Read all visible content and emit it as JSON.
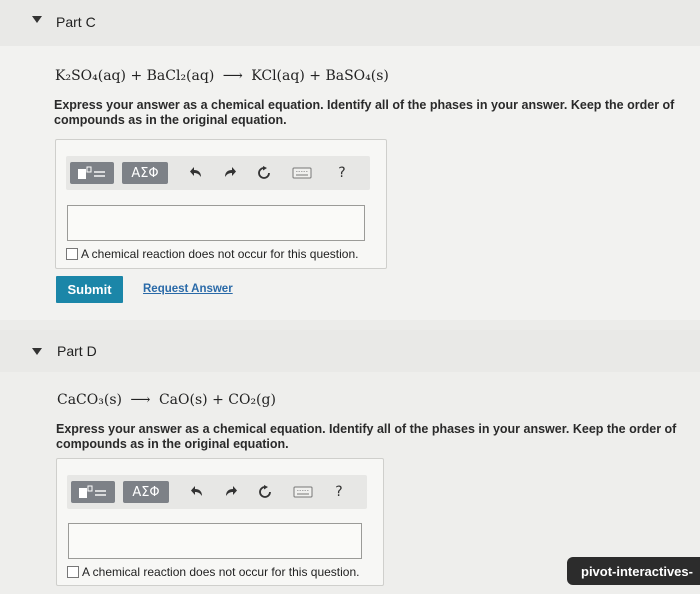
{
  "part_c": {
    "title": "Part C",
    "equation": {
      "reactant1": "K₂SO₄(aq)",
      "plus1": "+",
      "reactant2": "BaCl₂(aq)",
      "arrow": "⟶",
      "product1": "KCl(aq)",
      "plus2": "+",
      "product2": "BaSO₄(s)"
    },
    "instructions": "Express your answer as a chemical equation. Identify all of the phases in your answer. Keep the order of compounds as in the original equation.",
    "toolbar": {
      "greek_label": "ΑΣΦ",
      "help_label": "?"
    },
    "answer_value": "",
    "no_reaction_label": "A chemical reaction does not occur for this question.",
    "submit_label": "Submit",
    "request_answer_label": "Request Answer"
  },
  "part_d": {
    "title": "Part D",
    "equation": {
      "reactant1": "CaCO₃(s)",
      "arrow": "⟶",
      "product1": "CaO(s)",
      "plus1": "+",
      "product2": "CO₂(g)"
    },
    "instructions": "Express your answer as a chemical equation. Identify all of the phases in your answer. Keep the order of compounds as in the original equation.",
    "toolbar": {
      "greek_label": "ΑΣΦ",
      "help_label": "?"
    },
    "answer_value": "",
    "no_reaction_label": "A chemical reaction does not occur for this question."
  },
  "badge_label": "pivot-interactives-"
}
